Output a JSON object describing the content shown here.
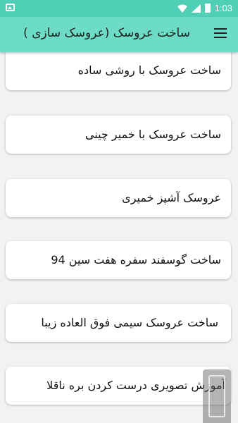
{
  "status_bar": {
    "time": "1:03",
    "icons": [
      "image-icon",
      "wifi-icon",
      "signal-icon",
      "battery-icon"
    ]
  },
  "app_bar": {
    "title": "ساخت عروسک (عروسک سازی )",
    "menu_icon": "hamburger-menu-icon"
  },
  "items": [
    {
      "label": "ساخت عروسک با روشی ساده"
    },
    {
      "label": "ساخت عروسک با خمیر چینی"
    },
    {
      "label": "عروسک آشپز خمیری"
    },
    {
      "label": "ساخت  گوسفند  سفره هفت سین 94"
    },
    {
      "label": "ساخت عروسک سیمی فوق العاده زیبا"
    },
    {
      "label": "آموزش تصویری درست کردن بره ناقلا"
    }
  ],
  "colors": {
    "status_bar": "#4fcfb6",
    "app_bar": "#6ddcc6",
    "background": "#f2f2f2"
  }
}
